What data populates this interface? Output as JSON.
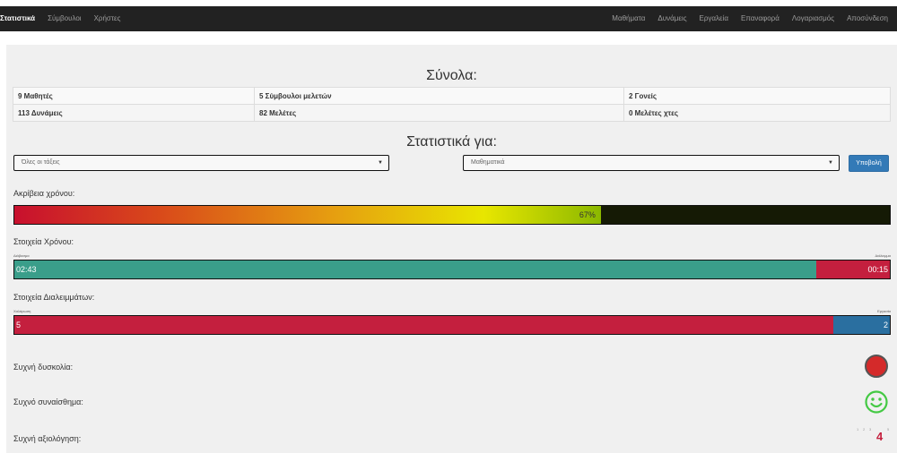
{
  "nav": {
    "left": [
      "Στατιστικά",
      "Σύμβουλοι",
      "Χρήστες"
    ],
    "right": [
      "Μαθήματα",
      "Δυνάμεις",
      "Εργαλεία",
      "Επαναφορά",
      "Λογαριασμός",
      "Αποσύνδεση"
    ]
  },
  "totals": {
    "title": "Σύνολα:",
    "rows": [
      [
        "9 Μαθητές",
        "5 Σύμβουλοι μελετών",
        "2 Γονείς"
      ],
      [
        "113 Δυνάμεις",
        "82 Μελέτες",
        "0 Μελέτες χτες"
      ]
    ]
  },
  "stats": {
    "title": "Στατιστικά για:",
    "class_select": "Όλες οι τάξεις",
    "subject_select": "Μαθηματικά",
    "submit": "Υποβολή"
  },
  "time_accuracy": {
    "label": "Ακρίβεια χρόνου:",
    "percent": 67,
    "text": "67%"
  },
  "time_data": {
    "label": "Στοιχεία Χρόνου:",
    "left_caption": "Διάβασμα",
    "right_caption": "Διάλειμμα",
    "study": "02:43",
    "break": "00:15",
    "study_fraction": 0.916
  },
  "break_data": {
    "label": "Στοιχεία Διαλειμμάτων:",
    "left_caption": "Χαλάρωση",
    "right_caption": "Εργασία",
    "relax": "5",
    "work": "2",
    "relax_fraction": 0.935
  },
  "frequent": {
    "difficulty": "Συχνή δυσκολία:",
    "emotion": "Συχνό συναίσθημα:",
    "rating": "Συχνή αξιολόγηση:",
    "difficulty_color": "#d42a2a",
    "emotion_icon": "smile-icon",
    "rating_scale": [
      "1",
      "2",
      "3",
      "4",
      "5"
    ],
    "rating_value": "4"
  }
}
